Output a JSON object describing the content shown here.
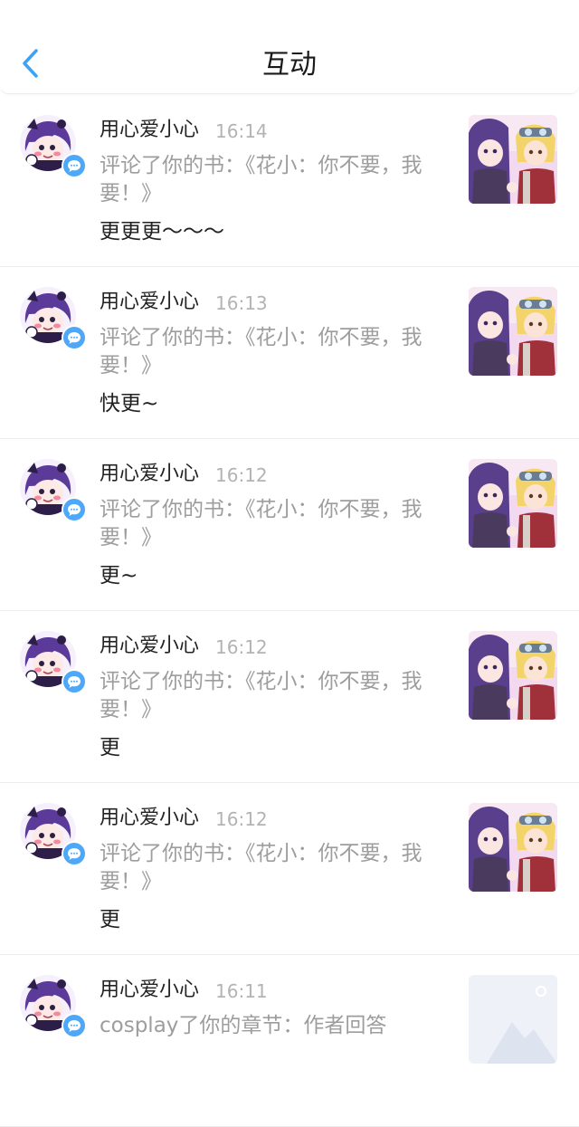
{
  "header": {
    "title": "互动"
  },
  "items": [
    {
      "name": "用心爱小心",
      "time": "16:14",
      "desc": "评论了你的书：《花小：你不要，我要！》",
      "comment": "更更更～～～"
    },
    {
      "name": "用心爱小心",
      "time": "16:13",
      "desc": "评论了你的书：《花小：你不要，我要！》",
      "comment": "快更~"
    },
    {
      "name": "用心爱小心",
      "time": "16:12",
      "desc": "评论了你的书：《花小：你不要，我要！》",
      "comment": "更~"
    },
    {
      "name": "用心爱小心",
      "time": "16:12",
      "desc": "评论了你的书：《花小：你不要，我要！》",
      "comment": "更"
    },
    {
      "name": "用心爱小心",
      "time": "16:12",
      "desc": "评论了你的书：《花小：你不要，我要！》",
      "comment": "更"
    },
    {
      "name": "用心爱小心",
      "time": "16:11",
      "desc": "cosplay了你的章节：作者回答",
      "comment": ""
    }
  ],
  "colors": {
    "accent": "#3ea2f2",
    "badge": "#4ea7f7"
  },
  "icons": {
    "back": "chevron-left-icon",
    "badge": "comment-bubble-icon"
  }
}
